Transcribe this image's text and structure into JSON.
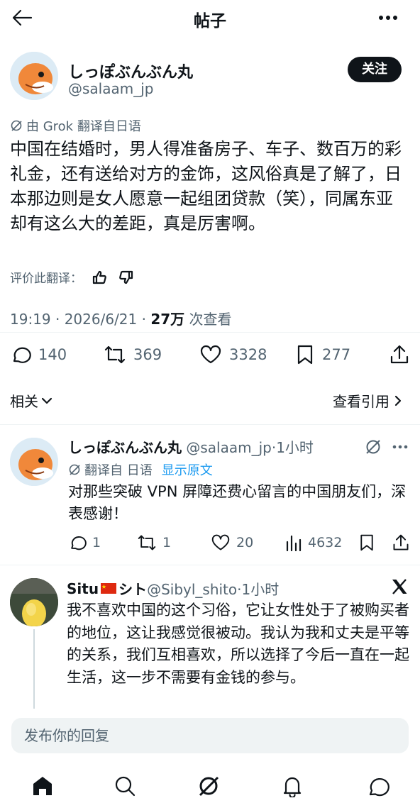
{
  "header": {
    "title": "帖子"
  },
  "post": {
    "author_name": "しっぽぶんぶん丸",
    "author_handle": "@salaam_jp",
    "follow_label": "关注",
    "translation_note": "由 Grok 翻译自日语",
    "text": "中国在结婚时，男人得准备房子、车子、数百万的彩礼金，还有送给对方的金饰，这风俗真是了解了，日本那边则是女人愿意一起组团贷款（笑），同属东亚却有这么大的差距，真是厉害啊。",
    "rate_translation_label": "评价此翻译：",
    "time": "19:19 · 2026/6/21 · ",
    "views_count": "27万",
    "views_label": " 次查看",
    "stats": {
      "replies": "140",
      "reposts": "369",
      "likes": "3328",
      "bookmarks": "277"
    }
  },
  "related": {
    "label": "相关",
    "quotes_label": "查看引用"
  },
  "replies": [
    {
      "author_name": "しっぽぶんぶん丸",
      "meta": " @salaam_jp·1小时",
      "translation_note": "翻译自 日语",
      "show_original": "显示原文",
      "text": "对那些突破 VPN 屏障还费心留言的中国朋友们，深表感谢！",
      "stats": {
        "replies": "1",
        "reposts": "1",
        "likes": "20",
        "views": "4632"
      }
    },
    {
      "author_name": "Situ",
      "author_suffix": "シト",
      "meta": " @Sibyl_shito·1小时",
      "text": "我不喜欢中国的这个习俗，它让女性处于了被购买者的地位，这让我感觉很被动。我认为我和丈夫是平等的关系，我们互相喜欢，所以选择了今后一直在一起生活，这一步不需要有金钱的参与。"
    }
  ],
  "reply_bar": {
    "placeholder": "发布你的回复"
  },
  "nav": [
    "home-icon",
    "search-icon",
    "grok-icon",
    "notifications-icon",
    "messages-icon"
  ],
  "colors": {
    "accent": "#1d9bf0",
    "text": "#0f1419",
    "secondary": "#536471"
  }
}
